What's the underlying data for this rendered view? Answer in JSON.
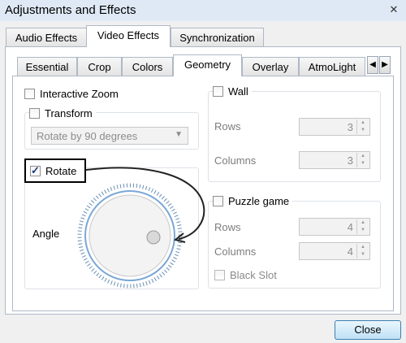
{
  "window": {
    "title": "Adjustments and Effects",
    "close_icon": "close-icon"
  },
  "top_tabs": [
    "Audio Effects",
    "Video Effects",
    "Synchronization"
  ],
  "top_tabs_selected": "Video Effects",
  "sub_tabs": [
    "Essential",
    "Crop",
    "Colors",
    "Geometry",
    "Overlay",
    "AtmoLight"
  ],
  "sub_tabs_selected": "Geometry",
  "interactive_zoom": {
    "label": "Interactive Zoom",
    "checked": false
  },
  "transform": {
    "label": "Transform",
    "checked": false,
    "combo_value": "Rotate by 90 degrees"
  },
  "rotate": {
    "label": "Rotate",
    "checked": true,
    "angle_label": "Angle"
  },
  "wall": {
    "label": "Wall",
    "checked": false,
    "rows_label": "Rows",
    "rows_value": "3",
    "columns_label": "Columns",
    "columns_value": "3"
  },
  "puzzle": {
    "label": "Puzzle game",
    "checked": false,
    "rows_label": "Rows",
    "rows_value": "4",
    "columns_label": "Columns",
    "columns_value": "4",
    "black_slot_label": "Black Slot",
    "black_slot_checked": false
  },
  "close_button": "Close",
  "colors": {
    "accent": "#3c7fb1",
    "dial_tick": "#6a8fb5",
    "highlight": "#000000"
  }
}
